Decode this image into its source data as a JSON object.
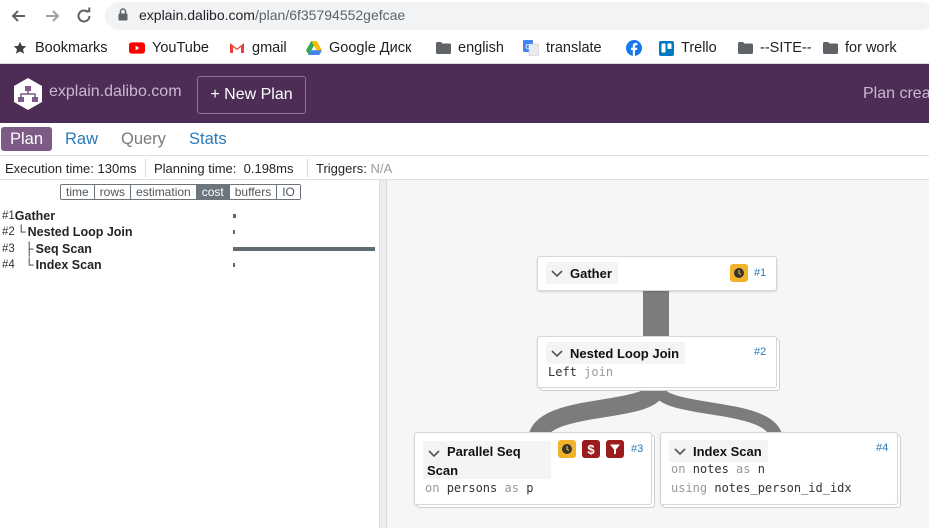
{
  "browser": {
    "url_host": "explain.dalibo.com",
    "url_path": "/plan/6f35794552gefcae",
    "bookmarks": [
      {
        "label": "Bookmarks",
        "icon": "star-icon"
      },
      {
        "label": "YouTube",
        "icon": "youtube-icon"
      },
      {
        "label": "gmail",
        "icon": "gmail-icon"
      },
      {
        "label": "Google Диск",
        "icon": "google-drive-icon"
      },
      {
        "label": "english",
        "icon": "folder-icon"
      },
      {
        "label": "translate",
        "icon": "google-translate-icon"
      },
      {
        "label": "",
        "icon": "facebook-icon"
      },
      {
        "label": "Trello",
        "icon": "trello-icon"
      },
      {
        "label": "--SITE--",
        "icon": "folder-icon"
      },
      {
        "label": "for work",
        "icon": "folder-icon"
      }
    ]
  },
  "header": {
    "brand": "explain.dalibo.com",
    "new_plan": "+ New Plan",
    "right_text": "Plan crea"
  },
  "tabs": [
    "Plan",
    "Raw",
    "Query",
    "Stats"
  ],
  "stats": {
    "execution_label": "Execution time:",
    "execution_value": "130ms",
    "planning_label": "Planning time:",
    "planning_value": "0.198ms",
    "triggers_label": "Triggers:",
    "triggers_value": "N/A"
  },
  "metrics": {
    "buttons": [
      "time",
      "rows",
      "estimation",
      "cost",
      "buffers",
      "IO"
    ],
    "selected": "cost"
  },
  "tree": [
    {
      "num": "#1",
      "prefix": "",
      "name": "Gather",
      "cost_fraction": 0.02
    },
    {
      "num": "#2",
      "prefix": "└",
      "name": "Nested Loop Join",
      "cost_fraction": 0.0
    },
    {
      "num": "#3",
      "prefix": "├",
      "name": "Seq Scan",
      "cost_fraction": 1.0
    },
    {
      "num": "#4",
      "prefix": "└",
      "name": "Index Scan",
      "cost_fraction": 0.0
    }
  ],
  "nodes": {
    "gather": {
      "title": "Gather",
      "id": "#1"
    },
    "nested": {
      "title": "Nested Loop Join",
      "id": "#2",
      "sub_a": "Left",
      "sub_b": "join"
    },
    "seq": {
      "title_1": "Parallel Seq",
      "title_2": "Scan",
      "id": "#3",
      "sub_kw": "on",
      "sub_table": "persons",
      "sub_as": "as",
      "sub_alias": "p"
    },
    "index": {
      "title": "Index Scan",
      "id": "#4",
      "on_kw": "on",
      "on_table": "notes",
      "on_as": "as",
      "on_alias": "n",
      "using_kw": "using",
      "using_index": "notes_person_id_idx"
    }
  },
  "colors": {
    "header_bg": "#4d2d55",
    "active_tab": "#7d5b86",
    "link": "#2a7ab8",
    "badge_time": "#f0b32a",
    "badge_cost": "#9b1c1c",
    "badge_filter": "#9b1c1c"
  }
}
